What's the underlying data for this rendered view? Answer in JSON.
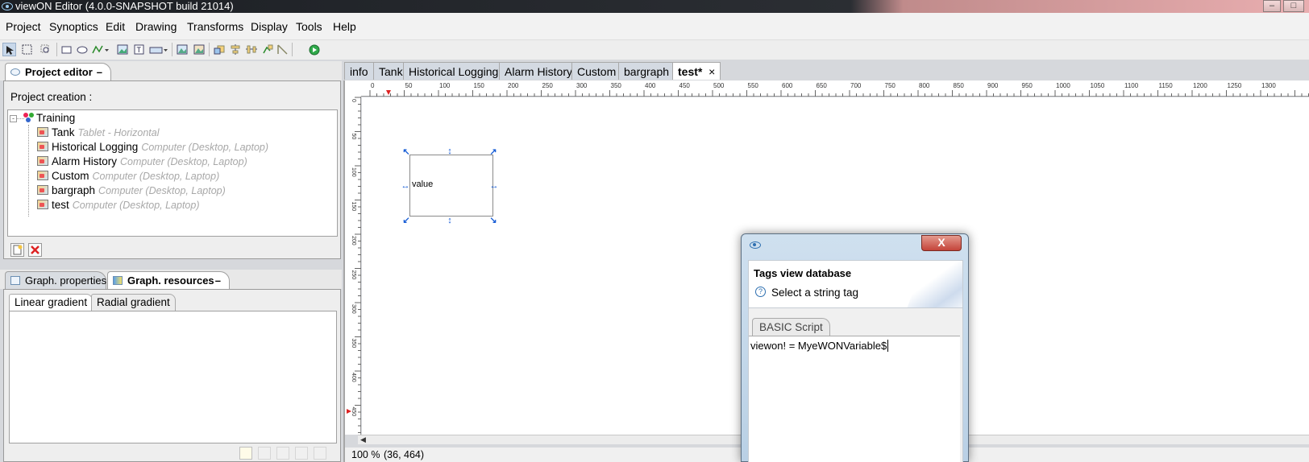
{
  "window": {
    "title": "viewON Editor (4.0.0-SNAPSHOT build 21014)",
    "min_icon": "minimize-icon",
    "max_icon": "maximize-icon"
  },
  "menu": [
    "Project",
    "Synoptics",
    "Edit",
    "Drawing",
    "Transforms",
    "Display",
    "Tools",
    "Help"
  ],
  "toolbar_icons": [
    "select-arrow-icon",
    "marquee-select-icon",
    "zoom-select-icon",
    "rectangle-icon",
    "ellipse-icon",
    "polyline-icon",
    "image-icon",
    "text-icon",
    "widget-icon",
    "picture-icon",
    "picture-2-icon",
    "bring-front-icon",
    "align-icon",
    "distribute-icon",
    "group-icon",
    "line-icon",
    "run-icon"
  ],
  "project_editor": {
    "tab_label": "Project editor",
    "tab_close": "–",
    "creation_label": "Project creation :",
    "root": "Training",
    "items": [
      {
        "name": "Tank",
        "target": "Tablet - Horizontal"
      },
      {
        "name": "Historical Logging",
        "target": "Computer (Desktop, Laptop)"
      },
      {
        "name": "Alarm History",
        "target": "Computer (Desktop, Laptop)"
      },
      {
        "name": "Custom",
        "target": "Computer (Desktop, Laptop)"
      },
      {
        "name": "bargraph",
        "target": "Computer (Desktop, Laptop)"
      },
      {
        "name": "test",
        "target": "Computer (Desktop, Laptop)"
      }
    ]
  },
  "lower_panel": {
    "tab_properties": "Graph. properties",
    "tab_resources": "Graph. resources",
    "tab_close": "–",
    "subtab_linear": "Linear gradient",
    "subtab_radial": "Radial gradient"
  },
  "editor_tabs": [
    "info",
    "Tank",
    "Historical Logging",
    "Alarm History",
    "Custom",
    "bargraph",
    "test*"
  ],
  "editor_tab_close": "×",
  "ruler_h_labels": [
    "0",
    "50",
    "100",
    "150",
    "200",
    "250",
    "300",
    "350",
    "400",
    "450",
    "500",
    "550",
    "600",
    "650",
    "700",
    "750",
    "800",
    "850",
    "900",
    "950",
    "1000",
    "1050",
    "1100",
    "1150",
    "1200",
    "1250",
    "1300"
  ],
  "ruler_v_labels": [
    "0",
    "50",
    "100",
    "150",
    "200",
    "250",
    "300",
    "350",
    "400",
    "450"
  ],
  "canvas": {
    "element_text": "value"
  },
  "status": {
    "zoom": "100 %",
    "coords": "(36, 464)"
  },
  "dialog": {
    "close_label": "X",
    "title": "Tags view database",
    "subtitle": "Select a string tag",
    "tab": "BASIC Script",
    "script": "viewon! = MyeWONVariable$"
  }
}
